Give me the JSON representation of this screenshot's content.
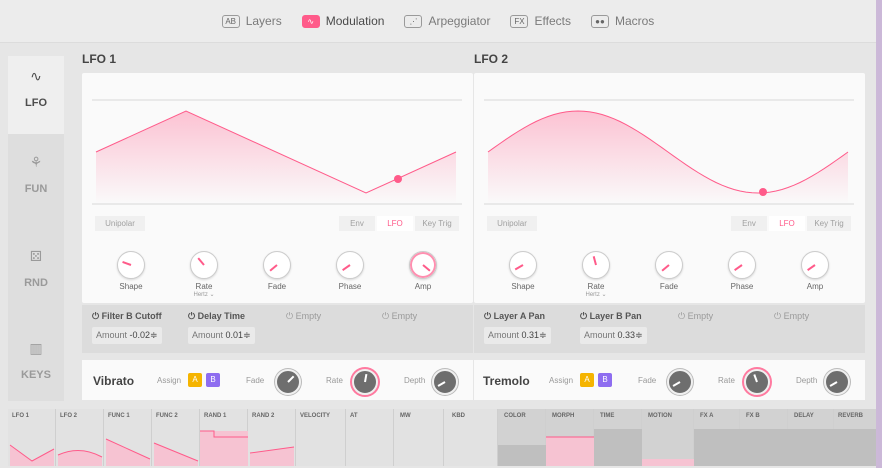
{
  "nav": {
    "items": [
      {
        "icon": "AB",
        "label": "Layers",
        "active": false
      },
      {
        "icon": "∿",
        "label": "Modulation",
        "active": true
      },
      {
        "icon": "⋰",
        "label": "Arpeggiator",
        "active": false
      },
      {
        "icon": "FX",
        "label": "Effects",
        "active": false
      },
      {
        "icon": "●●",
        "label": "Macros",
        "active": false
      }
    ],
    "accent": "#ff5b8a"
  },
  "sidebar": {
    "items": [
      {
        "glyph": "∿",
        "label": "LFO",
        "active": true
      },
      {
        "glyph": "⚘",
        "label": "FUN",
        "active": false
      },
      {
        "glyph": "⚄",
        "label": "RND",
        "active": false
      },
      {
        "glyph": "▥",
        "label": "KEYS",
        "active": false
      }
    ]
  },
  "lfo1": {
    "title": "LFO 1",
    "unipolar": "Unipolar",
    "modes": [
      "Env",
      "LFO",
      "Key Trig"
    ],
    "knobs": [
      {
        "label": "Shape",
        "sub": ""
      },
      {
        "label": "Rate",
        "sub": "Hertz ⌄"
      },
      {
        "label": "Fade",
        "sub": ""
      },
      {
        "label": "Phase",
        "sub": ""
      },
      {
        "label": "Amp",
        "sub": ""
      }
    ],
    "slots": [
      {
        "title": "Filter B Cutoff",
        "amount_label": "Amount",
        "amount": "-0.02≑"
      },
      {
        "title": "Delay Time",
        "amount_label": "Amount",
        "amount": "0.01≑"
      },
      {
        "title": "Empty"
      },
      {
        "title": "Empty"
      }
    ]
  },
  "lfo2": {
    "title": "LFO 2",
    "unipolar": "Unipolar",
    "modes": [
      "Env",
      "LFO",
      "Key Trig"
    ],
    "knobs": [
      {
        "label": "Shape",
        "sub": ""
      },
      {
        "label": "Rate",
        "sub": "Hertz ⌄"
      },
      {
        "label": "Fade",
        "sub": ""
      },
      {
        "label": "Phase",
        "sub": ""
      },
      {
        "label": "Amp",
        "sub": ""
      }
    ],
    "slots": [
      {
        "title": "Layer A Pan",
        "amount_label": "Amount",
        "amount": "0.31≑"
      },
      {
        "title": "Layer B Pan",
        "amount_label": "Amount",
        "amount": "0.33≑"
      },
      {
        "title": "Empty"
      },
      {
        "title": "Empty"
      }
    ]
  },
  "vibrato": {
    "title": "Vibrato",
    "assign": "Assign",
    "a": "A",
    "b": "B",
    "fade": "Fade",
    "rate": "Rate",
    "depth": "Depth"
  },
  "tremolo": {
    "title": "Tremolo",
    "assign": "Assign",
    "a": "A",
    "b": "B",
    "fade": "Fade",
    "rate": "Rate",
    "depth": "Depth"
  },
  "strip": {
    "cells": [
      "LFO 1",
      "LFO 2",
      "FUNC 1",
      "FUNC 2",
      "RAND 1",
      "RAND 2",
      "VELOCITY",
      "AT",
      "MW",
      "KBD",
      "COLOR",
      "MORPH",
      "TIME",
      "MOTION",
      "FX A",
      "FX B",
      "DELAY",
      "REVERB"
    ]
  },
  "colors": {
    "accent": "#ff5b8a",
    "a_button": "#f5b400",
    "b_button": "#8e6df0"
  }
}
